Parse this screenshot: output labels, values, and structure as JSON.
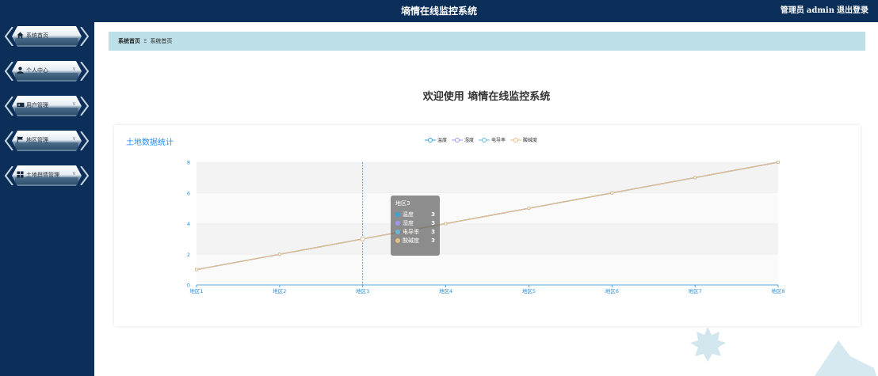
{
  "header": {
    "title": "墒情在线监控系统",
    "user_role": "管理员",
    "user_name": "admin",
    "logout_label": "退出登录"
  },
  "sidebar": {
    "items": [
      {
        "label": "系统首页",
        "icon": "home-icon",
        "has_submenu": false
      },
      {
        "label": "个人中心",
        "icon": "user-icon",
        "has_submenu": true
      },
      {
        "label": "用户管理",
        "icon": "users-icon",
        "has_submenu": true
      },
      {
        "label": "地区管理",
        "icon": "flag-icon",
        "has_submenu": true
      },
      {
        "label": "土地舆情管理",
        "icon": "grid-icon",
        "has_submenu": true
      }
    ]
  },
  "breadcrumb": {
    "home": "系统首页",
    "separator": "Ξ",
    "current": "系统首页"
  },
  "welcome": "欢迎使用 墒情在线监控系统",
  "card": {
    "title": "土地数据统计"
  },
  "tooltip": {
    "title": "地区3",
    "rows": [
      {
        "name": "温度",
        "value": "3"
      },
      {
        "name": "湿度",
        "value": "3"
      },
      {
        "name": "电导率",
        "value": "3"
      },
      {
        "name": "酸碱度",
        "value": "3"
      }
    ]
  },
  "chart_data": {
    "type": "line",
    "title": "土地数据统计",
    "categories": [
      "地区1",
      "地区2",
      "地区3",
      "地区4",
      "地区5",
      "地区6",
      "地区7",
      "地区8"
    ],
    "series": [
      {
        "name": "温度",
        "values": [
          1,
          2,
          3,
          4,
          5,
          6,
          7,
          8
        ],
        "color": "#37a2da"
      },
      {
        "name": "湿度",
        "values": [
          1,
          2,
          3,
          4,
          5,
          6,
          7,
          8
        ],
        "color": "#9d96f5"
      },
      {
        "name": "电导率",
        "values": [
          1,
          2,
          3,
          4,
          5,
          6,
          7,
          8
        ],
        "color": "#67b7dc"
      },
      {
        "name": "酸碱度",
        "values": [
          1,
          2,
          3,
          4,
          5,
          6,
          7,
          8
        ],
        "color": "#e7bc87"
      }
    ],
    "yticks": [
      0,
      2,
      4,
      6,
      8
    ],
    "ylim": [
      0,
      8
    ],
    "grid": true,
    "legend_position": "top-center",
    "highlight_category": "地区3"
  },
  "colors": {
    "navy": "#0c2f5a",
    "breadcrumb_bg": "#bcdfe8",
    "accent": "#1e90ff"
  }
}
